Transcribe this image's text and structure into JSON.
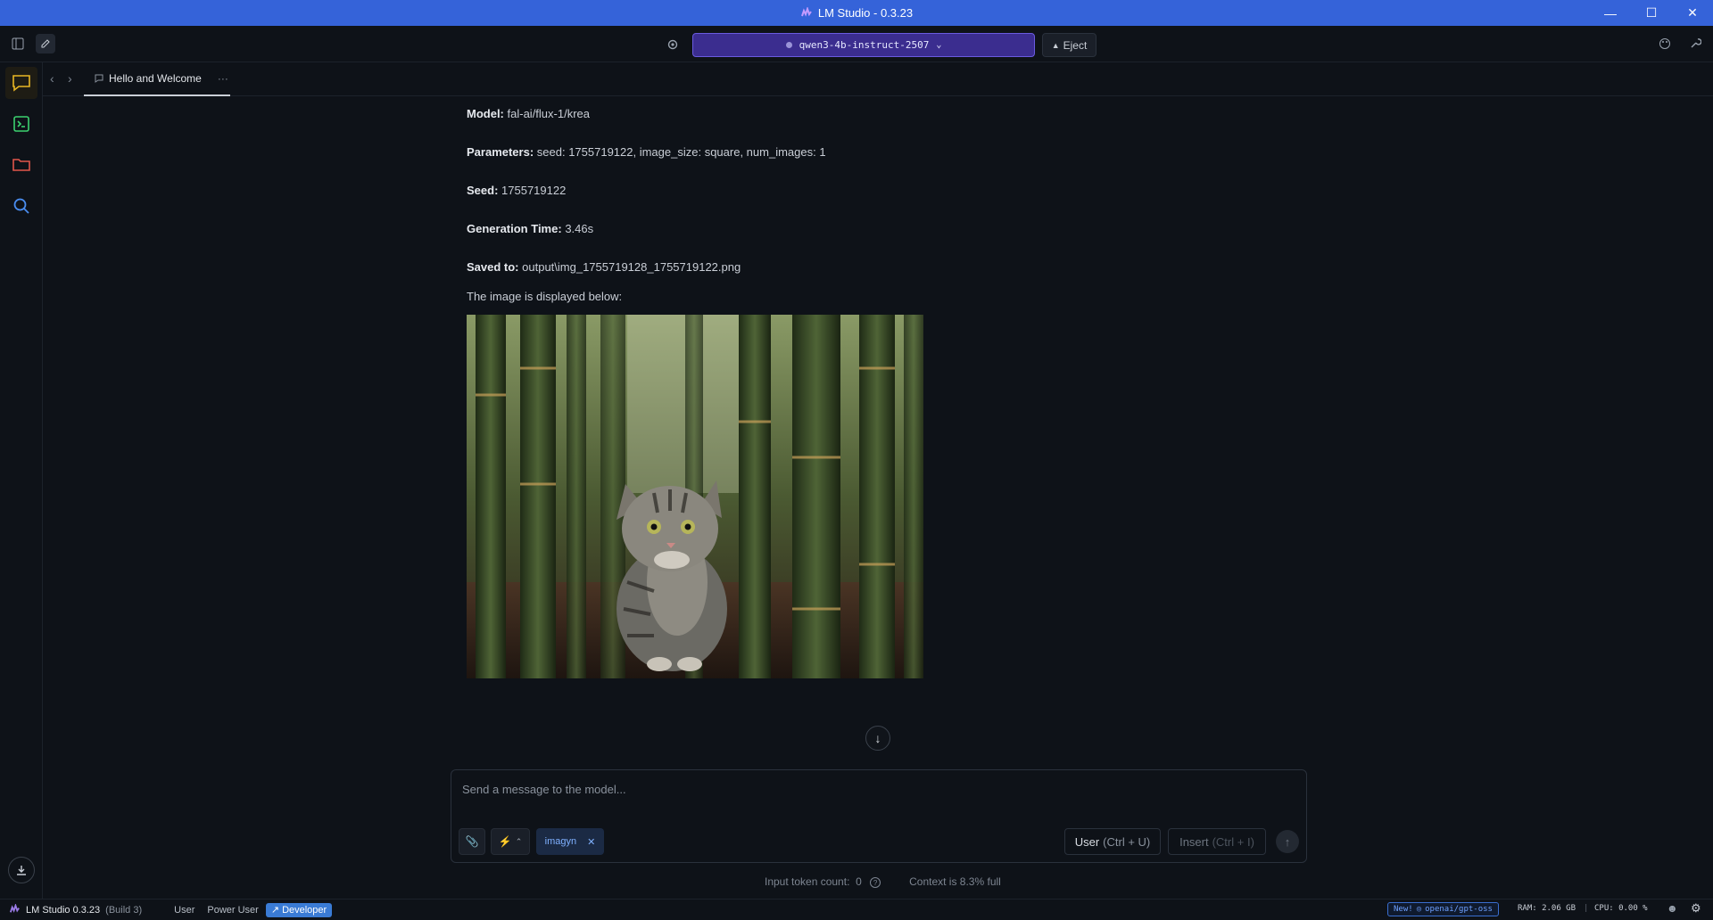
{
  "window": {
    "title": "LM Studio - 0.3.23",
    "controls": [
      "minimize-icon",
      "maximize-icon",
      "close-icon"
    ]
  },
  "toolbar": {
    "model_name": "qwen3-4b-instruct-2507",
    "eject_label": "Eject"
  },
  "sidebar": {
    "items": [
      {
        "name": "chat",
        "icon": "chat-bubble-icon",
        "active": true
      },
      {
        "name": "developer",
        "icon": "terminal-icon",
        "active": false
      },
      {
        "name": "my-models",
        "icon": "folder-icon",
        "active": false
      },
      {
        "name": "discover",
        "icon": "search-icon",
        "active": false
      }
    ]
  },
  "tab": {
    "label": "Hello and Welcome"
  },
  "message": {
    "model_label": "Model:",
    "model_value": "fal-ai/flux-1/krea",
    "params_label": "Parameters:",
    "params_value": "seed: 1755719122, image_size: square, num_images: 1",
    "seed_label": "Seed:",
    "seed_value": "1755719122",
    "gen_label": "Generation Time:",
    "gen_value": "3.46s",
    "saved_label": "Saved to:",
    "saved_value": "output\\img_1755719128_1755719122.png",
    "image_caption": "The image is displayed below:"
  },
  "composer": {
    "placeholder": "Send a message to the model...",
    "plugin_chip": "imagyn",
    "user_mode_label": "User",
    "user_mode_shortcut": "(Ctrl + U)",
    "insert_label": "Insert",
    "insert_shortcut": "(Ctrl + I)",
    "token_count_label": "Input token count:",
    "token_count_value": "0",
    "context_label": "Context is 8.3% full"
  },
  "statusbar": {
    "app_name": "LM Studio 0.3.23",
    "build": "(Build 3)",
    "modes": [
      "User",
      "Power User",
      "Developer"
    ],
    "active_mode": "Developer",
    "new_badge_prefix": "New!",
    "new_badge_model": "openai/gpt-oss",
    "ram": "RAM: 2.06 GB",
    "cpu": "CPU: 0.00 %"
  },
  "colors": {
    "titlebar": "#3563d9",
    "model_select_bg": "#3b2d8f",
    "accent_active_mode": "#3a7bd5",
    "chat_icon": "#e8b624",
    "terminal_icon": "#3bd16f",
    "folder_icon": "#e2564a",
    "search_icon": "#4a8df0"
  }
}
